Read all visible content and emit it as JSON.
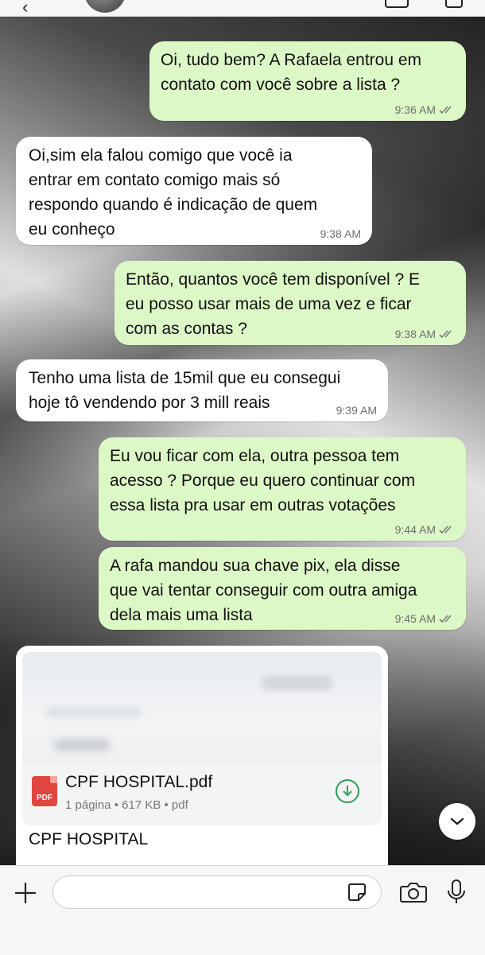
{
  "messages": [
    {
      "direction": "out",
      "text": "Oi, tudo bem? A Rafaela entrou em contato com você sobre a lista ?",
      "time": "9:36 AM"
    },
    {
      "direction": "in",
      "text": "Oi,sim ela falou comigo que você ia entrar em contato comigo mais só respondo quando é indicação de quem eu conheço",
      "time": "9:38 AM"
    },
    {
      "direction": "out",
      "text": "Então, quantos você tem disponível ? E eu posso usar mais de uma vez e ficar com as contas ?",
      "time": "9:38 AM"
    },
    {
      "direction": "in",
      "text": "Tenho uma lista de 15mil que eu consegui hoje tô vendendo por 3 mill reais",
      "time": "9:39 AM"
    },
    {
      "direction": "out",
      "text": "Eu vou ficar com ela, outra pessoa tem acesso ? Porque eu quero continuar com essa lista pra usar em outras votações",
      "time": "9:44 AM"
    },
    {
      "direction": "out",
      "text": "A rafa mandou sua chave pix, ela disse que vai tentar conseguir com outra amiga dela mais uma lista",
      "time": "9:45 AM"
    }
  ],
  "lines": {
    "m0": [
      "Oi, tudo bem? A Rafaela entrou em",
      "contato com você sobre a lista ?"
    ],
    "m1": [
      "Oi,sim ela falou comigo que você ia",
      "entrar em contato comigo mais só",
      "respondo quando é indicação de quem",
      "eu conheço"
    ],
    "m2": [
      "Então, quantos você tem disponível ? E",
      "eu posso usar mais de uma vez e ficar",
      "com as contas ?"
    ],
    "m3": [
      "Tenho uma lista de 15mil que eu consegui",
      "hoje tô vendendo por 3 mill reais"
    ],
    "m4": [
      "Eu vou ficar com ela, outra pessoa tem",
      "acesso ? Porque eu quero continuar com",
      "essa lista pra usar em outras votações"
    ],
    "m5": [
      "A rafa mandou sua chave pix, ela disse",
      "que vai tentar conseguir com outra amiga",
      "dela mais uma lista"
    ]
  },
  "document": {
    "file_name": "CPF HOSPITAL.pdf",
    "file_meta": "1 página • 617 KB • pdf",
    "type_badge": "PDF",
    "caption": "CPF HOSPITAL"
  },
  "composer": {
    "placeholder": "",
    "value": ""
  },
  "icons": {
    "read_receipt": "double-check-icon",
    "attach": "plus-icon",
    "sticker": "sticker-icon",
    "camera": "camera-icon",
    "mic": "microphone-icon",
    "scroll": "chevron-down-icon",
    "download": "download-icon"
  },
  "colors": {
    "outgoing_bubble": "#dcf8c6",
    "incoming_bubble": "#ffffff",
    "download_accent": "#2e9e5b",
    "pdf_badge": "#e0463f"
  }
}
